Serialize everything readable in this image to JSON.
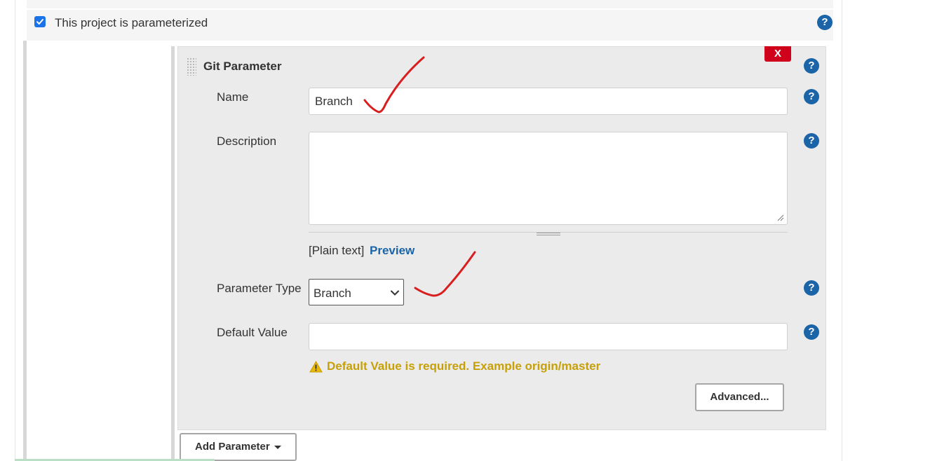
{
  "parameterized": {
    "checked": true,
    "label": "This project is parameterized"
  },
  "parameter_block": {
    "title": "Git Parameter",
    "delete_label": "X",
    "fields": {
      "name": {
        "label": "Name",
        "value": "Branch"
      },
      "description": {
        "label": "Description",
        "value": ""
      },
      "parameter_type": {
        "label": "Parameter Type",
        "selected": "Branch"
      },
      "default_value": {
        "label": "Default Value",
        "value": ""
      }
    },
    "format": {
      "plain_text": "[Plain text]",
      "preview_link": "Preview"
    },
    "warning": "Default Value is required. Example origin/master",
    "advanced_button": "Advanced..."
  },
  "add_parameter_button": "Add Parameter",
  "help_label": "?",
  "icons": {
    "help": "help-icon",
    "warning": "warning-triangle-icon",
    "drag": "drag-handle-icon",
    "dropdown": "chevron-down-icon"
  },
  "colors": {
    "help": "#1b64a8",
    "delete": "#d0021b",
    "warning": "#c7a008",
    "link": "#1b64a8",
    "annotation": "#d81e1e"
  }
}
